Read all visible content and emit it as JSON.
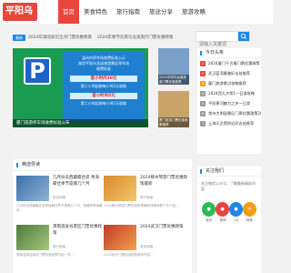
{
  "header": {
    "logo_text": "平阳乌",
    "nav": [
      "首页",
      "美食特色",
      "旅行指南",
      "旅途分享",
      "旅游攻略"
    ]
  },
  "breadcrumb": {
    "tag": "最新",
    "items": [
      "2024年湖北知识全点门票优惠政策",
      "2024年春节云南乌龙溪旅行门票优惠政策"
    ]
  },
  "search": {
    "placeholder": "请输入关键词"
  },
  "banner": {
    "lines": [
      "温州市停车场收费标准公示",
      "湖北平阳乌龙溪旅游景区停车场",
      "收费标准"
    ],
    "prices": [
      "首小时内10元",
      "第二小时起按每小时2元收取",
      "首小时内5元",
      "第二小时起按每小时1元收取"
    ],
    "caption": "厦门旅游停车场收费标准公布"
  },
  "thumbs": [
    {
      "caption": "2024平阳乌龙溪旅游门票优惠政策"
    },
    {
      "caption": "厦门旅游门票优惠政策推荐"
    }
  ],
  "side": {
    "title": "今日头条",
    "items": [
      "2024厦门千古情门票优惠政策",
      "武汉蓝湾最美好去处推荐",
      "厦门旅游景点攻略推荐",
      "2024西九大桥1一日游攻略",
      "平阳黄河魅力之乡一日游",
      "常州大明园景区门票优惠政策2024年",
      "上海天文馆附近好去处推荐"
    ]
  },
  "follow": {
    "title": "关注我们",
    "text": "关注微信公众号，了解最新精彩内容",
    "socials": [
      "微信",
      "微博",
      "QQ",
      "邮箱"
    ]
  },
  "featured": {
    "title": "精选导读",
    "cards": [
      {
        "title": "几月份去西藏最合适 青海最佳季节是哪几个月",
        "meta": "旅游攻略",
        "desc": "几月份去西藏最合适青海最佳季节是哪几个月，西藏和青海最佳..."
      },
      {
        "title": "2024柳州琴游门票优惠政策最新",
        "meta": "旅行指南",
        "desc": "2024柳州琴游门票优惠政策最新详情请看下文介绍..."
      },
      {
        "title": "渭南温泉谷景区门票优惠政策",
        "meta": "旅行指南",
        "desc": "渭南温泉谷景区门票优惠政策内容一览..."
      },
      {
        "title": "2024武汉门票优惠政策",
        "meta": "旅游攻略",
        "desc": "2024武汉门票优惠政策具体内容..."
      }
    ]
  },
  "colors": {
    "accent": "#e8453c",
    "primary": "#1e88e5",
    "banner_bg": "#1a9b52"
  }
}
